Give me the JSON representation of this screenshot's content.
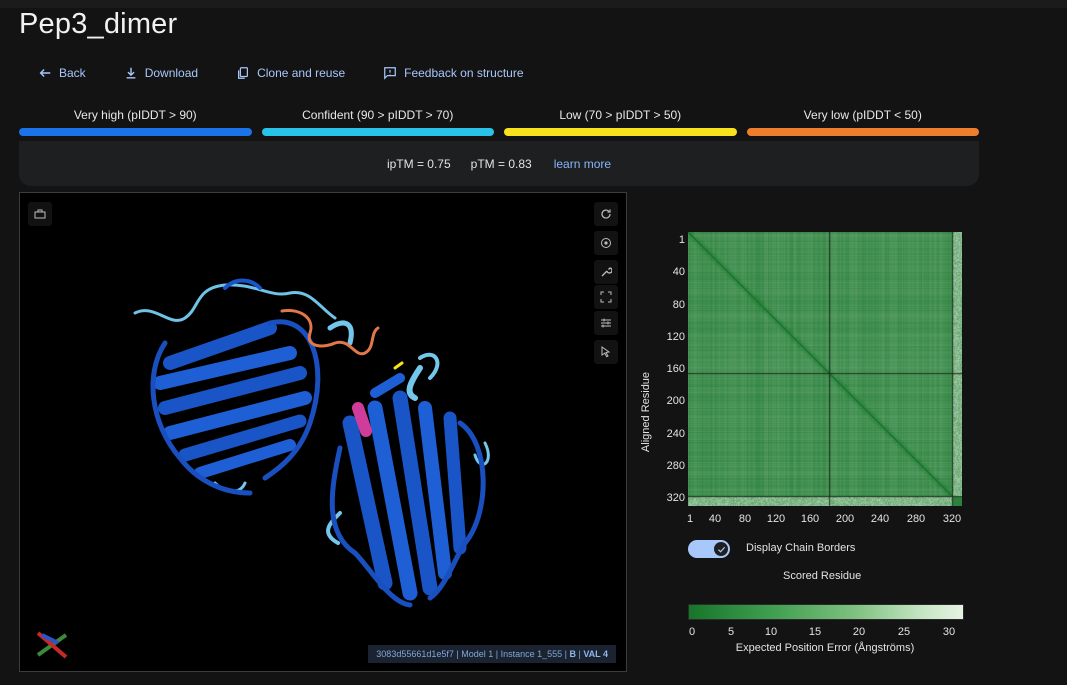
{
  "page": {
    "title": "Pep3_dimer"
  },
  "actions": [
    {
      "label": "Back",
      "icon": "arrow-left-icon"
    },
    {
      "label": "Download",
      "icon": "download-icon"
    },
    {
      "label": "Clone and reuse",
      "icon": "copy-icon"
    },
    {
      "label": "Feedback on structure",
      "icon": "feedback-icon"
    }
  ],
  "plddt_legend": [
    {
      "label": "Very high (pIDDT > 90)",
      "color": "#1a73e8"
    },
    {
      "label": "Confident (90 > pIDDT > 70)",
      "color": "#29b6f6"
    },
    {
      "label": "Low (70 > pIDDT > 50)",
      "color": "#f7e21b"
    },
    {
      "label": "Very low (pIDDT < 50)",
      "color": "#ef7d2b"
    }
  ],
  "metrics": {
    "iptm": "ipTM = 0.75",
    "ptm": "pTM = 0.83",
    "learn_more": "learn more"
  },
  "viewer": {
    "info_prefix": "3083d55661d1e5f7 | Model 1 | Instance 1_555 | ",
    "info_chain": "B",
    "info_sep": " | ",
    "info_residue": "VAL 4",
    "tools": [
      "refresh-icon",
      "settings-icon",
      "wrench-icon",
      "expand-icon",
      "sliders-icon",
      "pointer-icon"
    ]
  },
  "pae": {
    "y_axis_label": "Aligned Residue",
    "x_axis_label": "Scored Residue",
    "y_ticks": [
      "1",
      "40",
      "80",
      "120",
      "160",
      "200",
      "240",
      "280",
      "320"
    ],
    "x_ticks": [
      "1",
      "40",
      "80",
      "120",
      "160",
      "200",
      "240",
      "280",
      "320"
    ],
    "toggle_label": "Display Chain Borders",
    "toggle_on": true,
    "colorbar_ticks": [
      "0",
      "5",
      "10",
      "15",
      "20",
      "25",
      "30"
    ],
    "colorbar_label": "Expected Position Error (Ångströms)",
    "chain_border_residue": 171,
    "peptide_border_residue": 320,
    "total_residues": 332
  }
}
